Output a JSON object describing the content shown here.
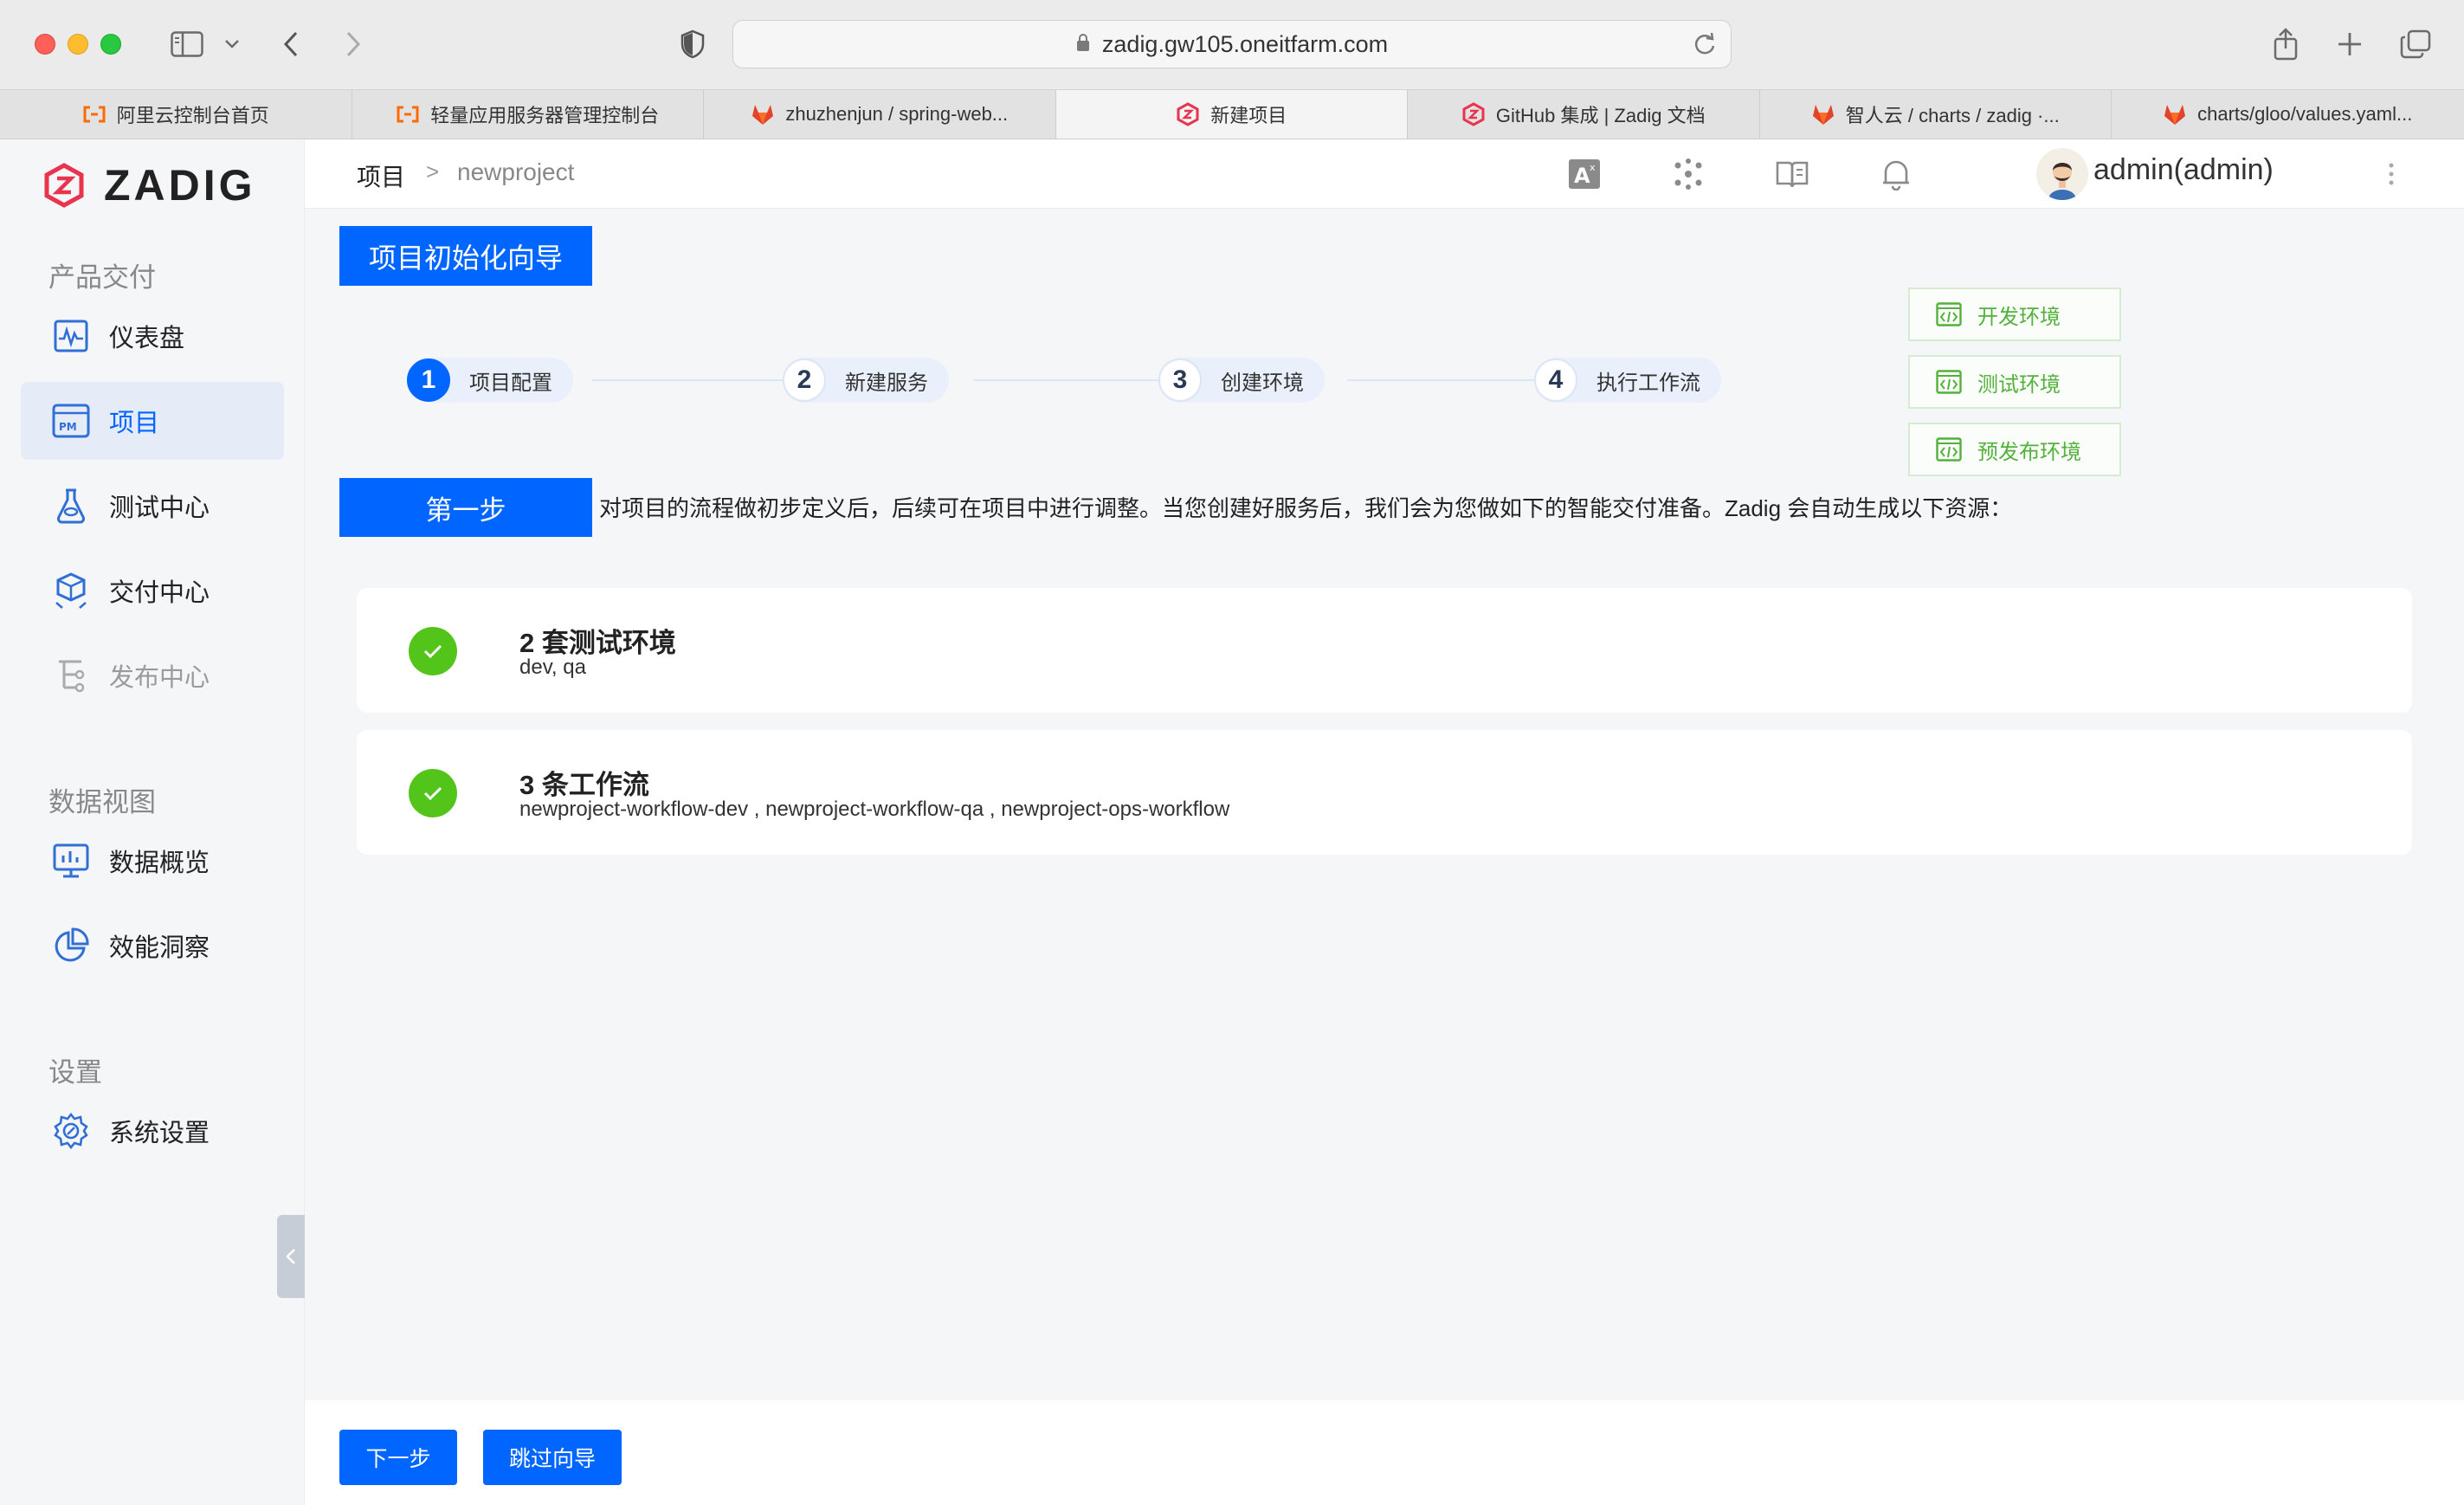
{
  "browser": {
    "url": "zadig.gw105.oneitfarm.com",
    "tabs": [
      {
        "label": "阿里云控制台首页",
        "icon": "aliyun-icon"
      },
      {
        "label": "轻量应用服务器管理控制台",
        "icon": "aliyun-icon"
      },
      {
        "label": "zhuzhenjun / spring-web...",
        "icon": "gitlab-icon"
      },
      {
        "label": "新建项目",
        "icon": "zadig-icon",
        "active": true
      },
      {
        "label": "GitHub 集成 | Zadig 文档",
        "icon": "zadig-icon"
      },
      {
        "label": "智人云 / charts / zadig ·...",
        "icon": "gitlab-icon"
      },
      {
        "label": "charts/gloo/values.yaml...",
        "icon": "gitlab-icon"
      }
    ]
  },
  "sidebar": {
    "logo": "ZADIG",
    "sections": {
      "delivery": "产品交付",
      "data": "数据视图",
      "settings": "设置"
    },
    "items": {
      "dashboard": "仪表盘",
      "projects": "项目",
      "testing": "测试中心",
      "delivery_center": "交付中心",
      "release": "发布中心",
      "data_overview": "数据概览",
      "insights": "效能洞察",
      "system_settings": "系统设置"
    }
  },
  "header": {
    "breadcrumb_root": "项目",
    "breadcrumb_sep": ">",
    "breadcrumb_current": "newproject",
    "user": "admin(admin)"
  },
  "wizard": {
    "title": "项目初始化向导",
    "steps": [
      {
        "num": "1",
        "label": "项目配置"
      },
      {
        "num": "2",
        "label": "新建服务"
      },
      {
        "num": "3",
        "label": "创建环境"
      },
      {
        "num": "4",
        "label": "执行工作流"
      }
    ],
    "envs": [
      "开发环境",
      "测试环境",
      "预发布环境"
    ],
    "step_badge": "第一步",
    "description": "对项目的流程做初步定义后，后续可在项目中进行调整。当您创建好服务后，我们会为您做如下的智能交付准备。Zadig 会自动生成以下资源：",
    "cards": [
      {
        "title": "2 套测试环境",
        "subtitle": "dev, qa"
      },
      {
        "title": "3 条工作流",
        "subtitle": "newproject-workflow-dev , newproject-workflow-qa , newproject-ops-workflow"
      }
    ],
    "next_button": "下一步",
    "skip_button": "跳过向导"
  },
  "colors": {
    "primary": "#0066ff",
    "success": "#52c41a",
    "env_green": "#52b13a"
  }
}
